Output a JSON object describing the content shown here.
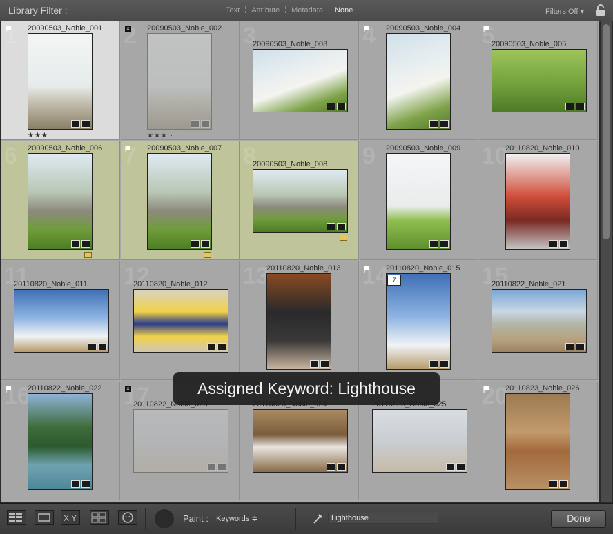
{
  "filter_bar": {
    "title": "Library Filter :",
    "modes": [
      "Text",
      "Attribute",
      "Metadata",
      "None"
    ],
    "active_mode": "None",
    "filters_status": "Filters Off"
  },
  "cells": [
    {
      "index": "1",
      "name": "20090503_Noble_001",
      "selected": true,
      "flag": "pick",
      "stars": "★★★"
    },
    {
      "index": "2",
      "name": "20090503_Noble_002",
      "flag": "reject",
      "stars": "★★★ · ·",
      "dim": true
    },
    {
      "index": "3",
      "name": "20090503_Noble_003"
    },
    {
      "index": "4",
      "name": "20090503_Noble_004",
      "flag": "pick"
    },
    {
      "index": "5",
      "name": "20090503_Noble_005",
      "flag": "pick"
    },
    {
      "index": "6",
      "name": "20090503_Noble_006",
      "green": true
    },
    {
      "index": "7",
      "name": "20090503_Noble_007",
      "green": true,
      "flag": "pick"
    },
    {
      "index": "8",
      "name": "20090503_Noble_008",
      "green": true
    },
    {
      "index": "9",
      "name": "20090503_Noble_009"
    },
    {
      "index": "10",
      "name": "20110820_Noble_010"
    },
    {
      "index": "11",
      "name": "20110820_Noble_011"
    },
    {
      "index": "12",
      "name": "20110820_Noble_012"
    },
    {
      "index": "13",
      "name": "20110820_Noble_013"
    },
    {
      "index": "14",
      "name": "20110820_Noble_015",
      "flag": "pick",
      "stack": "7"
    },
    {
      "index": "15",
      "name": "20110822_Noble_021"
    },
    {
      "index": "16",
      "name": "20110822_Noble_022",
      "flag": "pick"
    },
    {
      "index": "17",
      "name": "20110822_Noble_023",
      "flag": "reject",
      "dim": true
    },
    {
      "index": "18",
      "name": "20110823_Noble_024"
    },
    {
      "index": "19",
      "name": "20110823_Noble_025"
    },
    {
      "index": "20",
      "name": "20110823_Noble_026",
      "flag": "pick"
    }
  ],
  "toast": "Assigned Keyword: Lighthouse",
  "toolbar": {
    "paint_label": "Paint :",
    "paint_value": "Keywords ≑",
    "keyword_value": "Lighthouse",
    "done_label": "Done"
  },
  "colors": {
    "grid_bg": "#a7a7a7",
    "selected_bg": "#dcdcdc",
    "green_bg": "#bfc49a",
    "label_yellow": "#e6c75c"
  }
}
